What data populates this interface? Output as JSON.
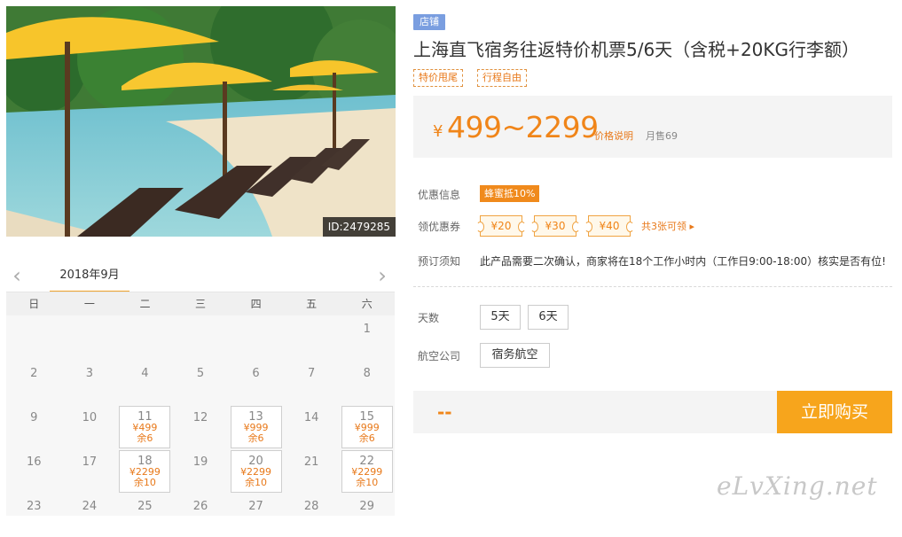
{
  "photo": {
    "id_label": "ID:2479285"
  },
  "product": {
    "shop_badge": "店铺",
    "title": "上海直飞宿务往返特价机票5/6天（含税+20KG行李额）",
    "tags": [
      "特价甩尾",
      "行程自由"
    ]
  },
  "price": {
    "currency": "¥",
    "range": "499~2299",
    "explain": "价格说明",
    "monthly_sales": "月售69"
  },
  "discount": {
    "label": "优惠信息",
    "badge": "蜂蜜抵10%"
  },
  "coupons": {
    "label": "领优惠券",
    "items": [
      "¥20",
      "¥30",
      "¥40"
    ],
    "more": "共3张可领 ▸"
  },
  "booking": {
    "label": "预订须知",
    "note": "此产品需要二次确认，商家将在18个工作小时内（工作日9:00-18:00）核实是否有位!"
  },
  "options": {
    "days_label": "天数",
    "days": [
      "5天",
      "6天"
    ],
    "airline_label": "航空公司",
    "airlines": [
      "宿务航空"
    ]
  },
  "buy": {
    "placeholder": "--",
    "button": "立即购买"
  },
  "calendar": {
    "prev": "‹",
    "next": "›",
    "month": "2018年9月",
    "weekdays": [
      "日",
      "一",
      "二",
      "三",
      "四",
      "五",
      "六"
    ],
    "rows": [
      [
        null,
        null,
        null,
        null,
        null,
        null,
        {
          "d": "1"
        }
      ],
      [
        {
          "d": "2"
        },
        {
          "d": "3"
        },
        {
          "d": "4"
        },
        {
          "d": "5"
        },
        {
          "d": "6"
        },
        {
          "d": "7"
        },
        {
          "d": "8"
        }
      ],
      [
        {
          "d": "9"
        },
        {
          "d": "10"
        },
        {
          "d": "11",
          "price": "¥499",
          "stock": "余6"
        },
        {
          "d": "12"
        },
        {
          "d": "13",
          "price": "¥999",
          "stock": "余6"
        },
        {
          "d": "14"
        },
        {
          "d": "15",
          "price": "¥999",
          "stock": "余6"
        }
      ],
      [
        {
          "d": "16"
        },
        {
          "d": "17"
        },
        {
          "d": "18",
          "price": "¥2299",
          "stock": "余10"
        },
        {
          "d": "19"
        },
        {
          "d": "20",
          "price": "¥2299",
          "stock": "余10"
        },
        {
          "d": "21"
        },
        {
          "d": "22",
          "price": "¥2299",
          "stock": "余10"
        }
      ],
      [
        {
          "d": "23"
        },
        {
          "d": "24"
        },
        {
          "d": "25"
        },
        {
          "d": "26"
        },
        {
          "d": "27"
        },
        {
          "d": "28"
        },
        {
          "d": "29"
        }
      ]
    ]
  },
  "watermark": "eLvXing.net"
}
